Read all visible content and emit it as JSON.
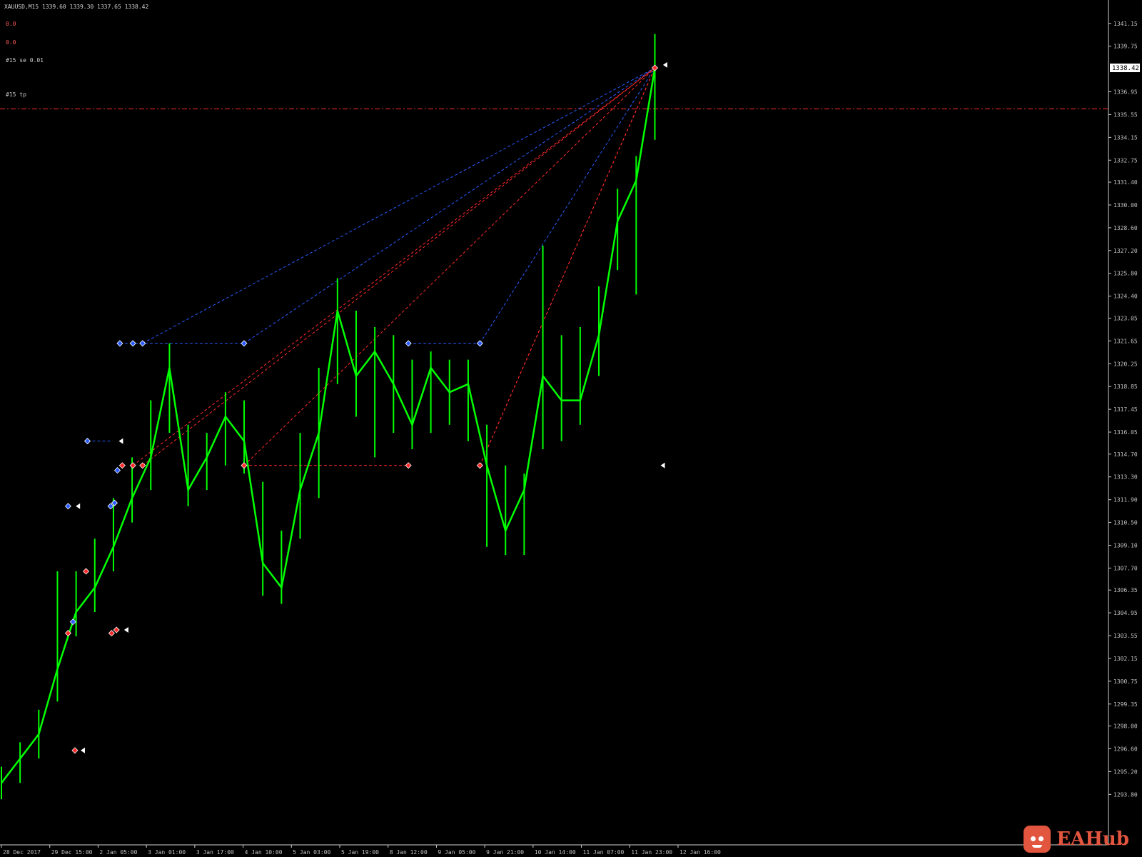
{
  "window": {
    "header_info": "XAUUSD,M15  1339.60 1339.30 1337.65 1338.42",
    "indicator_line_1": "0.0",
    "indicator_line_2": "0.0",
    "label_sell": "#15 se 0.01",
    "label_tp": "#15 tp",
    "current_price": "1338.42"
  },
  "watermark": {
    "text": "EAHub",
    "icon": "robot-face-icon",
    "color": "#e2553f"
  },
  "colors": {
    "background": "#000000",
    "candles": "#00ff00",
    "buy_marker": "#2a5bff",
    "sell_marker": "#ff2a2a",
    "tp_line": "#ff3030",
    "price_box": "#ffffff"
  },
  "chart_data": {
    "type": "line",
    "title": "",
    "xlabel": "",
    "ylabel": "",
    "grid": false,
    "ylim": [
      1290.7,
      1342.5
    ],
    "y_ticks": [
      "1341.15",
      "1339.75",
      "1336.95",
      "1335.55",
      "1334.15",
      "1332.75",
      "1331.40",
      "1330.00",
      "1328.60",
      "1327.20",
      "1325.80",
      "1324.40",
      "1323.05",
      "1321.65",
      "1320.25",
      "1318.85",
      "1317.45",
      "1316.05",
      "1314.70",
      "1313.30",
      "1311.90",
      "1310.50",
      "1309.10",
      "1307.70",
      "1306.35",
      "1304.95",
      "1303.55",
      "1302.15",
      "1300.75",
      "1299.35",
      "1298.00",
      "1296.60",
      "1295.20",
      "1293.80"
    ],
    "x_ticks": [
      "28 Dec 2017",
      "29 Dec 15:00",
      "2 Jan 05:00",
      "3 Jan 01:00",
      "3 Jan 17:00",
      "4 Jan 10:00",
      "5 Jan 03:00",
      "5 Jan 19:00",
      "8 Jan 12:00",
      "9 Jan 05:00",
      "9 Jan 21:00",
      "10 Jan 14:00",
      "11 Jan 07:00",
      "11 Jan 23:00",
      "12 Jan 16:00"
    ],
    "series": [
      {
        "x": [
          0,
          0.5,
          1,
          1.5,
          2,
          2.5,
          3,
          3.4,
          3.8,
          4.2,
          4.6,
          5,
          5.3,
          5.7,
          6,
          6.3,
          6.6,
          7,
          7.5,
          8,
          8.5,
          9,
          9.5,
          10,
          10.5,
          11,
          11.5,
          12,
          12.5,
          13,
          13.5,
          14,
          14.5,
          14.5
        ],
        "close": [
          1294.5,
          1296.0,
          1297.5,
          1301.5,
          1305.0,
          1306.5,
          1309.0,
          1312.0,
          1314.5,
          1320.0,
          1312.5,
          1314.5,
          1317.0,
          1315.5,
          1308.0,
          1306.5,
          1312.5,
          1316.0,
          1323.5,
          1319.5,
          1321.0,
          1319.0,
          1316.5,
          1320.0,
          1318.5,
          1319.0,
          1314.0,
          1310.0,
          1312.5,
          1319.5,
          1318.0,
          1318.0,
          1322.0,
          1329.0,
          1331.5,
          1338.42
        ],
        "high": [
          1295.5,
          1297.0,
          1299.0,
          1307.5,
          1307.5,
          1309.5,
          1312.0,
          1314.5,
          1318.0,
          1321.5,
          1316.5,
          1316.0,
          1318.5,
          1318.0,
          1313.0,
          1310.0,
          1316.0,
          1320.0,
          1325.5,
          1323.5,
          1322.5,
          1322.0,
          1320.5,
          1321.0,
          1320.5,
          1320.5,
          1316.5,
          1314.0,
          1313.5,
          1327.5,
          1322.0,
          1322.5,
          1325.0,
          1331.0,
          1333.0,
          1340.5
        ],
        "low": [
          1293.5,
          1294.5,
          1296.0,
          1299.5,
          1303.5,
          1305.0,
          1307.5,
          1310.5,
          1312.5,
          1316.0,
          1311.5,
          1312.5,
          1314.0,
          1313.5,
          1306.0,
          1305.5,
          1309.5,
          1312.0,
          1319.0,
          1317.0,
          1314.5,
          1316.0,
          1315.0,
          1316.0,
          1316.5,
          1315.5,
          1309.0,
          1308.5,
          1308.5,
          1315.0,
          1315.5,
          1316.5,
          1319.5,
          1326.0,
          1324.5,
          1334.0
        ]
      }
    ],
    "tp_level": 1335.9,
    "buy_orders": [
      {
        "x": 2.45,
        "price": 1321.5
      },
      {
        "x": 2.72,
        "price": 1321.5
      },
      {
        "x": 2.92,
        "price": 1321.5
      },
      {
        "x": 5.02,
        "price": 1321.5
      },
      {
        "x": 8.42,
        "price": 1321.5
      },
      {
        "x": 9.9,
        "price": 1321.5
      },
      {
        "x": 1.78,
        "price": 1315.5
      },
      {
        "x": 1.38,
        "price": 1311.5
      },
      {
        "x": 1.48,
        "price": 1304.4
      },
      {
        "x": 2.26,
        "price": 1311.5
      },
      {
        "x": 2.34,
        "price": 1311.7
      },
      {
        "x": 2.4,
        "price": 1313.7
      }
    ],
    "sell_orders": [
      {
        "x": 2.5,
        "price": 1314.0
      },
      {
        "x": 2.72,
        "price": 1314.0
      },
      {
        "x": 2.92,
        "price": 1314.0
      },
      {
        "x": 5.02,
        "price": 1314.0
      },
      {
        "x": 8.42,
        "price": 1314.0
      },
      {
        "x": 9.9,
        "price": 1314.0
      },
      {
        "x": 1.75,
        "price": 1307.5
      },
      {
        "x": 1.38,
        "price": 1303.7
      },
      {
        "x": 2.28,
        "price": 1303.7
      },
      {
        "x": 2.38,
        "price": 1303.9
      },
      {
        "x": 1.52,
        "price": 1296.5
      },
      {
        "x": 13.52,
        "price": 1338.42
      }
    ],
    "close_target": {
      "x": 13.52,
      "price": 1338.42
    }
  }
}
